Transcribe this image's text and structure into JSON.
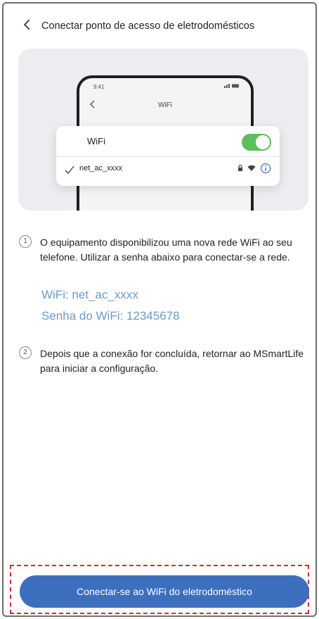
{
  "header": {
    "title": "Conectar ponto de acesso de eletrodomésticos",
    "back_icon": "chevron-left-icon"
  },
  "illustration": {
    "phone_time": "9:41",
    "phone_screen_title": "WiFi",
    "wifi_label": "WiFi",
    "wifi_toggle_on": true,
    "network_name": "net_ac_xxxx",
    "toggle_color": "#5bbf5b"
  },
  "steps": [
    {
      "number": "1",
      "text": "O equipamento disponibilizou uma nova rede WiFi ao seu telefone. Utilizar a senha abaixo para conectar-se a rede."
    },
    {
      "number": "2",
      "text": "Depois que a conexão for concluída, retornar ao MSmartLife para iniciar a configuração."
    }
  ],
  "credentials": {
    "wifi": "WiFi: net_ac_xxxx",
    "password": "Senha do WiFi: 12345678"
  },
  "cta": {
    "label": "Conectar-se ao WiFi do eletrodoméstico"
  },
  "colors": {
    "accent": "#3d6fbe",
    "credential_text": "#6a9bc3",
    "highlight_border": "#d32b2b"
  }
}
